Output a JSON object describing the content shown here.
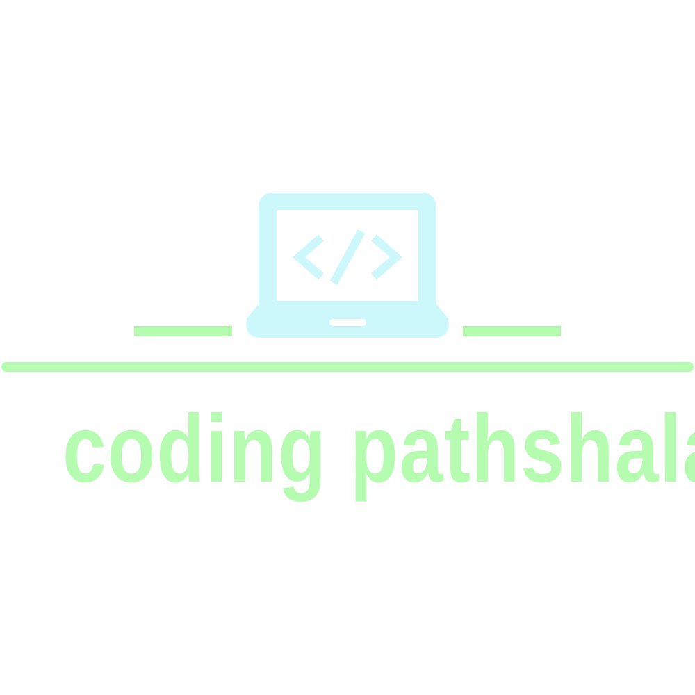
{
  "logo": {
    "brand_name": "coding pathshala",
    "icon": "laptop-code-icon",
    "colors": {
      "icon": "#cdf8fb",
      "text": "#b5fcb0",
      "lines": "#b5fcb0",
      "background": "#ffffff"
    }
  }
}
